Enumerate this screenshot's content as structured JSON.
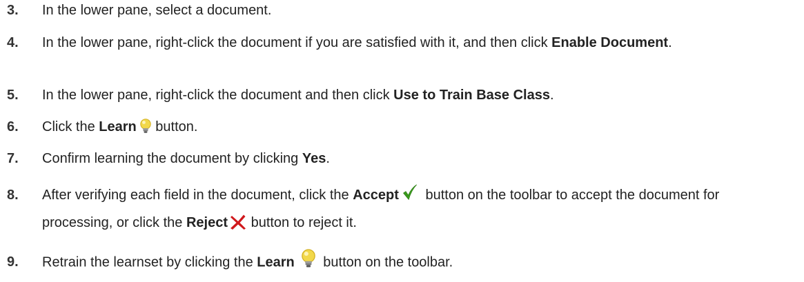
{
  "steps": [
    {
      "number": "3.",
      "text": "In the lower pane, select a document."
    },
    {
      "number": "4.",
      "pre": "In the lower pane, right-click the document if you are satisfied with it, and then click ",
      "bold": "Enable Document",
      "post": "."
    },
    {
      "number": "5.",
      "pre": "In the lower pane, right-click the document and then click ",
      "bold": "Use to Train Base Class",
      "post": "."
    },
    {
      "number": "6.",
      "pre": "Click the ",
      "bold": "Learn",
      "post": " button.",
      "icon": "lightbulb-icon"
    },
    {
      "number": "7.",
      "pre": "Confirm learning the document by clicking ",
      "bold": "Yes",
      "post": "."
    },
    {
      "number": "8.",
      "pre": "After verifying each field in the document, click the ",
      "bold": "Accept",
      "mid": " button on the toolbar to accept the document for processing, or click the ",
      "bold2": "Reject",
      "post": " button to reject it.",
      "icon": "checkmark-icon",
      "icon2": "x-icon"
    },
    {
      "number": "9.",
      "pre": "Retrain the learnset by clicking the ",
      "bold": "Learn",
      "post": " button on the toolbar.",
      "icon": "lightbulb-icon"
    }
  ],
  "colors": {
    "text": "#222222",
    "checkmark": "#3a9a1e",
    "reject_x": "#d0181c",
    "bulb": "#f2d84a"
  }
}
